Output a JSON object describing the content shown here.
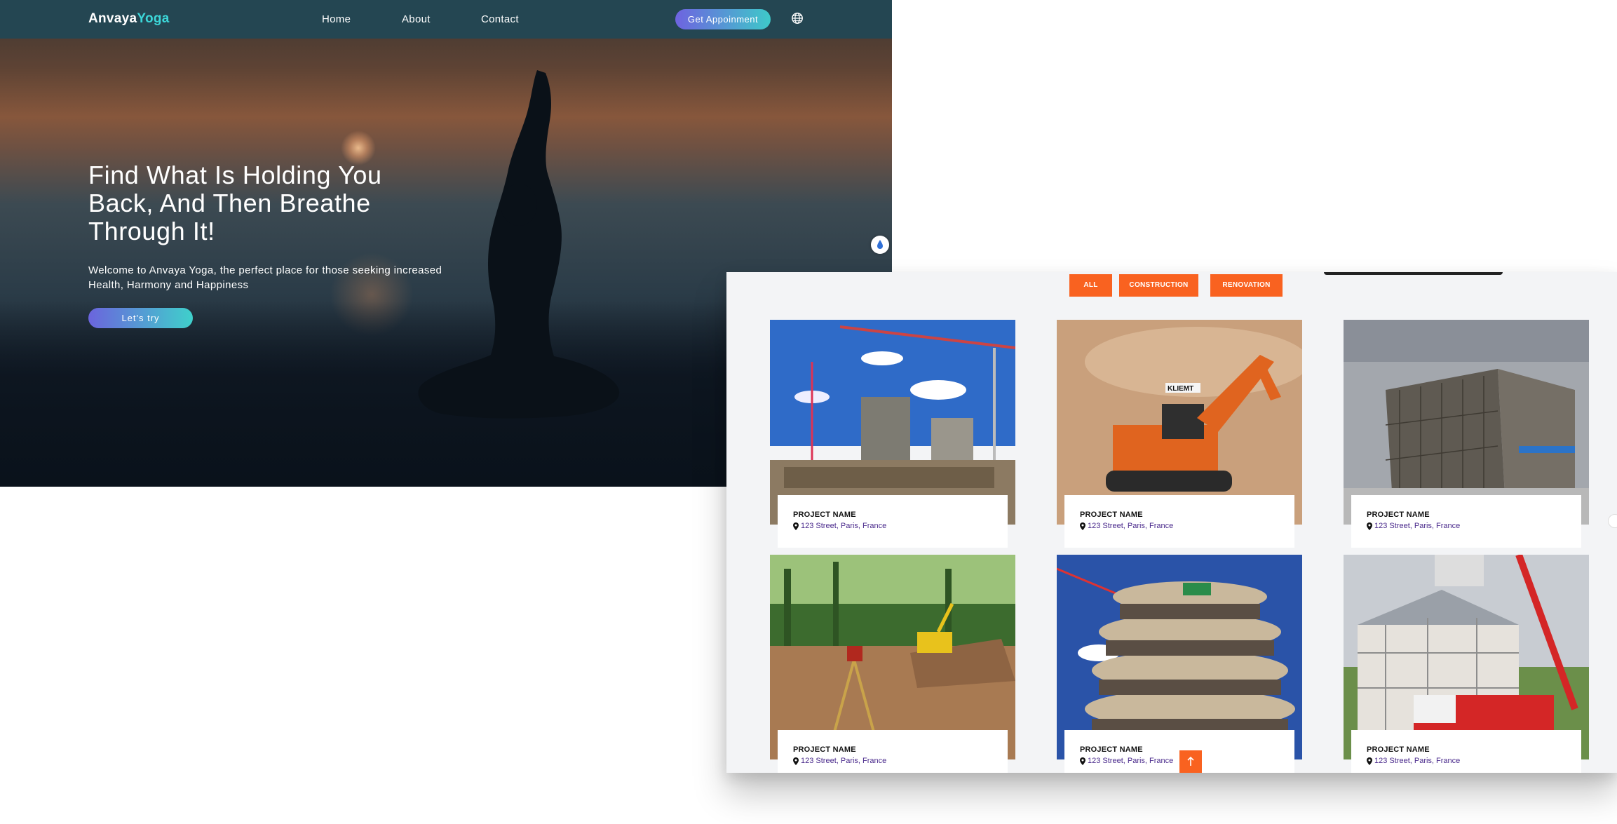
{
  "yoga": {
    "logo": {
      "part1": "Anvaya",
      "part2": "Yoga"
    },
    "nav": {
      "home": "Home",
      "about": "About",
      "contact": "Contact"
    },
    "appointment_btn": "Get Appoinment",
    "hero": {
      "title": "Find What Is Holding You Back, And Then Breathe Through It!",
      "subtitle": "Welcome to Anvaya Yoga, the perfect place for those seeking increased Health, Harmony and Happiness",
      "cta": "Let's try"
    },
    "colors": {
      "nav_bg": "#244652",
      "accent": "#3cd6d8",
      "gradient_start": "#6e63e0",
      "gradient_end": "#3ec9c9"
    }
  },
  "construction": {
    "filters": [
      "ALL",
      "CONSTRUCTION",
      "RENOVATION"
    ],
    "projects": [
      {
        "name": "PROJECT NAME",
        "location": "123 Street, Paris, France",
        "photo": "high-rise construction site with cranes"
      },
      {
        "name": "PROJECT NAME",
        "location": "123 Street, Paris, France",
        "photo": "orange KLIEMT excavator in sand"
      },
      {
        "name": "PROJECT NAME",
        "location": "123 Street, Paris, France",
        "photo": "rebar foundation construction site"
      },
      {
        "name": "PROJECT NAME",
        "location": "123 Street, Paris, France",
        "photo": "land survey with excavator in forest clearing"
      },
      {
        "name": "PROJECT NAME",
        "location": "123 Street, Paris, France",
        "photo": "curved concrete building under construction"
      },
      {
        "name": "PROJECT NAME",
        "location": "123 Street, Paris, France",
        "photo": "modular house with red crane"
      }
    ],
    "excavator_brand": "KLIEMT",
    "colors": {
      "accent": "#f96220",
      "location_text": "#4a2a8c"
    }
  }
}
